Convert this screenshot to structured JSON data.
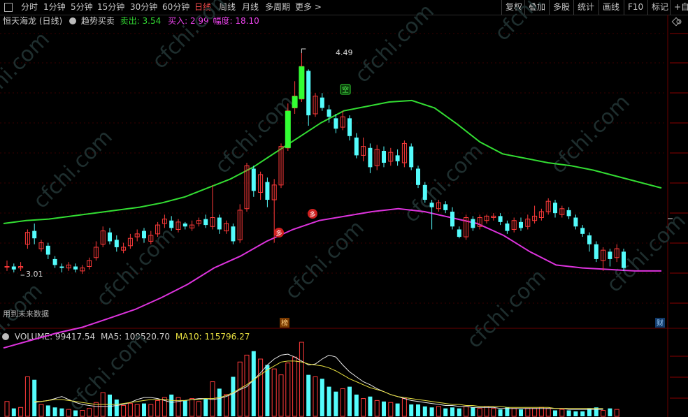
{
  "timeframes": {
    "items": [
      {
        "label": "分时",
        "active": false
      },
      {
        "label": "1分钟",
        "active": false
      },
      {
        "label": "5分钟",
        "active": false
      },
      {
        "label": "15分钟",
        "active": false
      },
      {
        "label": "30分钟",
        "active": false
      },
      {
        "label": "60分钟",
        "active": false
      },
      {
        "label": "日线",
        "active": true
      },
      {
        "label": "周线",
        "active": false
      },
      {
        "label": "月线",
        "active": false
      },
      {
        "label": "多周期",
        "active": false
      },
      {
        "label": "更多 >",
        "active": false
      }
    ]
  },
  "toolbar": {
    "items": [
      "复权",
      "叠加",
      "多股",
      "统计",
      "画线",
      "F10",
      "标记",
      "+自选"
    ]
  },
  "indicator_line": {
    "stock": "恒天海龙 (日线)",
    "indicator": "趋势买卖",
    "sell_label": "卖出: 3.54",
    "buy_label": "买入: 2.99",
    "range_label": "幅度: 18.10"
  },
  "price_chart": {
    "high_label": "4.49",
    "low_label": "3.01",
    "future_text": "用到未来数据",
    "marker_kong": "空",
    "marker_duo": "多",
    "tag_bang": "榜",
    "tag_cai": "财"
  },
  "volume_line": {
    "title": "VOLUME: 99417.54",
    "ma5": "MA5: 109520.70",
    "ma10": "MA10: 115796.27"
  },
  "watermark": "cfchi.com",
  "chart_data": {
    "type": "candlestick",
    "high": 4.49,
    "low": 3.01,
    "candles": [
      [
        3.05,
        3.05,
        3.02,
        3.09
      ],
      [
        3.05,
        3.03,
        3.01,
        3.07
      ],
      [
        3.04,
        3.05,
        3.02,
        3.08
      ],
      [
        3.2,
        3.28,
        3.17,
        3.3
      ],
      [
        3.29,
        3.24,
        3.2,
        3.34
      ],
      [
        3.17,
        3.21,
        3.15,
        3.23
      ],
      [
        3.19,
        3.13,
        3.1,
        3.21
      ],
      [
        3.1,
        3.06,
        3.04,
        3.12
      ],
      [
        3.05,
        3.04,
        3.01,
        3.07
      ],
      [
        3.04,
        3.06,
        3.02,
        3.08
      ],
      [
        3.05,
        3.03,
        3.01,
        3.07
      ],
      [
        3.02,
        3.04,
        3.0,
        3.06
      ],
      [
        3.05,
        3.09,
        3.03,
        3.11
      ],
      [
        3.11,
        3.18,
        3.09,
        3.22
      ],
      [
        3.2,
        3.29,
        3.18,
        3.32
      ],
      [
        3.28,
        3.22,
        3.2,
        3.31
      ],
      [
        3.23,
        3.18,
        3.15,
        3.26
      ],
      [
        3.16,
        3.18,
        3.14,
        3.21
      ],
      [
        3.19,
        3.24,
        3.17,
        3.27
      ],
      [
        3.25,
        3.27,
        3.22,
        3.3
      ],
      [
        3.29,
        3.24,
        3.21,
        3.31
      ],
      [
        3.22,
        3.26,
        3.2,
        3.29
      ],
      [
        3.27,
        3.33,
        3.25,
        3.35
      ],
      [
        3.34,
        3.37,
        3.31,
        3.4
      ],
      [
        3.36,
        3.31,
        3.29,
        3.39
      ],
      [
        3.3,
        3.35,
        3.28,
        3.37
      ],
      [
        3.34,
        3.32,
        3.3,
        3.35
      ],
      [
        3.31,
        3.33,
        3.29,
        3.36
      ],
      [
        3.34,
        3.36,
        3.32,
        3.38
      ],
      [
        3.37,
        3.33,
        3.31,
        3.4
      ],
      [
        3.32,
        3.38,
        3.3,
        3.6
      ],
      [
        3.38,
        3.3,
        3.27,
        3.4
      ],
      [
        3.29,
        3.34,
        3.27,
        3.36
      ],
      [
        3.32,
        3.22,
        3.2,
        3.34
      ],
      [
        3.23,
        3.43,
        3.21,
        3.47
      ],
      [
        3.44,
        3.73,
        3.42,
        3.75
      ],
      [
        3.71,
        3.56,
        3.52,
        3.73
      ],
      [
        3.55,
        3.67,
        3.5,
        3.69
      ],
      [
        3.62,
        3.5,
        3.45,
        3.65
      ],
      [
        3.5,
        3.6,
        3.21,
        3.64
      ],
      [
        3.6,
        3.86,
        3.58,
        3.88
      ],
      [
        3.85,
        4.1,
        3.83,
        4.15
      ],
      [
        4.12,
        4.2,
        4.08,
        4.3
      ],
      [
        4.18,
        4.4,
        4.16,
        4.49
      ],
      [
        4.37,
        4.07,
        4.0,
        4.38
      ],
      [
        4.08,
        4.2,
        4.06,
        4.22
      ],
      [
        4.19,
        4.12,
        4.1,
        4.22
      ],
      [
        4.11,
        4.06,
        4.02,
        4.14
      ],
      [
        4.05,
        3.98,
        3.95,
        4.08
      ],
      [
        3.99,
        4.06,
        3.97,
        4.1
      ],
      [
        4.05,
        3.93,
        3.9,
        4.07
      ],
      [
        3.92,
        3.8,
        3.78,
        3.95
      ],
      [
        3.8,
        3.86,
        3.76,
        3.92
      ],
      [
        3.85,
        3.72,
        3.68,
        3.88
      ],
      [
        3.73,
        3.84,
        3.7,
        3.87
      ],
      [
        3.83,
        3.75,
        3.72,
        3.86
      ],
      [
        3.76,
        3.82,
        3.73,
        3.85
      ],
      [
        3.8,
        3.76,
        3.73,
        3.84
      ],
      [
        3.75,
        3.88,
        3.72,
        3.9
      ],
      [
        3.86,
        3.72,
        3.7,
        3.88
      ],
      [
        3.71,
        3.6,
        3.58,
        3.73
      ],
      [
        3.6,
        3.5,
        3.48,
        3.62
      ],
      [
        3.48,
        3.45,
        3.3,
        3.5
      ],
      [
        3.44,
        3.48,
        3.42,
        3.5
      ],
      [
        3.47,
        3.43,
        3.41,
        3.49
      ],
      [
        3.42,
        3.32,
        3.3,
        3.45
      ],
      [
        3.3,
        3.25,
        3.24,
        3.32
      ],
      [
        3.25,
        3.38,
        3.23,
        3.4
      ],
      [
        3.37,
        3.31,
        3.29,
        3.39
      ],
      [
        3.32,
        3.38,
        3.3,
        3.4
      ],
      [
        3.36,
        3.39,
        3.34,
        3.4
      ],
      [
        3.38,
        3.39,
        3.36,
        3.41
      ],
      [
        3.39,
        3.35,
        3.33,
        3.41
      ],
      [
        3.34,
        3.29,
        3.27,
        3.36
      ],
      [
        3.3,
        3.36,
        3.28,
        3.38
      ],
      [
        3.35,
        3.31,
        3.29,
        3.38
      ],
      [
        3.32,
        3.37,
        3.3,
        3.4
      ],
      [
        3.36,
        3.39,
        3.34,
        3.46
      ],
      [
        3.38,
        3.42,
        3.36,
        3.44
      ],
      [
        3.42,
        3.49,
        3.4,
        3.51
      ],
      [
        3.48,
        3.41,
        3.38,
        3.5
      ],
      [
        3.4,
        3.44,
        3.38,
        3.46
      ],
      [
        3.43,
        3.39,
        3.37,
        3.45
      ],
      [
        3.38,
        3.32,
        3.3,
        3.4
      ],
      [
        3.31,
        3.27,
        3.25,
        3.33
      ],
      [
        3.26,
        3.2,
        3.15,
        3.28
      ],
      [
        3.2,
        3.1,
        3.08,
        3.22
      ],
      [
        3.09,
        3.16,
        3.02,
        3.18
      ],
      [
        3.15,
        3.1,
        3.05,
        3.17
      ],
      [
        3.11,
        3.17,
        3.08,
        3.2
      ],
      [
        3.15,
        3.04,
        3.02,
        3.17
      ]
    ],
    "upper_band": [
      3.34,
      3.36,
      3.37,
      3.39,
      3.41,
      3.43,
      3.45,
      3.48,
      3.52,
      3.58,
      3.64,
      3.72,
      3.82,
      3.92,
      4.02,
      4.1,
      4.13,
      4.16,
      4.17,
      4.12,
      4.01,
      3.89,
      3.81,
      3.78,
      3.75,
      3.73,
      3.7,
      3.66,
      3.62,
      3.58
    ],
    "lower_band": [
      2.5,
      2.55,
      2.6,
      2.64,
      2.7,
      2.76,
      2.84,
      2.93,
      3.04,
      3.12,
      3.22,
      3.3,
      3.36,
      3.39,
      3.42,
      3.44,
      3.42,
      3.38,
      3.34,
      3.26,
      3.15,
      3.06,
      3.04,
      3.03,
      3.02,
      3.02
    ],
    "volume": [
      15,
      8,
      9,
      40,
      37,
      12,
      11,
      9,
      8,
      7,
      6,
      6,
      8,
      14,
      24,
      22,
      17,
      11,
      13,
      12,
      13,
      12,
      16,
      19,
      22,
      19,
      16,
      18,
      15,
      18,
      35,
      28,
      22,
      40,
      55,
      62,
      66,
      58,
      52,
      48,
      42,
      54,
      60,
      75,
      42,
      40,
      38,
      30,
      25,
      28,
      30,
      22,
      18,
      20,
      16,
      15,
      14,
      13,
      18,
      12,
      12,
      10,
      9,
      10,
      8,
      9,
      8,
      10,
      9,
      8,
      10,
      8,
      7,
      9,
      8,
      7,
      8,
      8,
      9,
      8,
      6,
      7,
      6,
      5,
      5,
      8,
      9,
      6,
      8,
      7
    ],
    "ma5": [
      14,
      15,
      16,
      18,
      20,
      17,
      14,
      12,
      11,
      10,
      10,
      10,
      11,
      12,
      14,
      17,
      19,
      19,
      18,
      16,
      14,
      15,
      16,
      17,
      18,
      18,
      17,
      18,
      20,
      23,
      27,
      30,
      37,
      44,
      52,
      58,
      62,
      63,
      60,
      56,
      52,
      53,
      58,
      62,
      60,
      52,
      45,
      40,
      35,
      32,
      28,
      25,
      22,
      20,
      18,
      16,
      15,
      14,
      13,
      12,
      11,
      11,
      10,
      10,
      9,
      9,
      9,
      9,
      8,
      8,
      8,
      8,
      8,
      8,
      8,
      8,
      8,
      8,
      7,
      7,
      7,
      7,
      7,
      7
    ],
    "ma10": [
      15,
      15,
      16,
      17,
      17,
      16,
      15,
      14,
      13,
      12,
      12,
      12,
      12,
      13,
      14,
      15,
      16,
      17,
      17,
      17,
      16,
      16,
      16,
      17,
      17,
      18,
      18,
      19,
      21,
      24,
      28,
      32,
      37,
      42,
      47,
      51,
      55,
      56,
      56,
      55,
      53,
      52,
      51,
      49,
      46,
      42,
      38,
      35,
      32,
      29,
      27,
      25,
      22,
      20,
      19,
      18,
      17,
      16,
      15,
      14,
      13,
      12,
      12,
      11,
      11,
      10,
      10,
      10,
      10,
      9,
      9,
      9,
      9,
      9,
      9,
      9,
      8,
      8,
      8,
      8,
      8,
      8,
      8,
      8
    ]
  }
}
